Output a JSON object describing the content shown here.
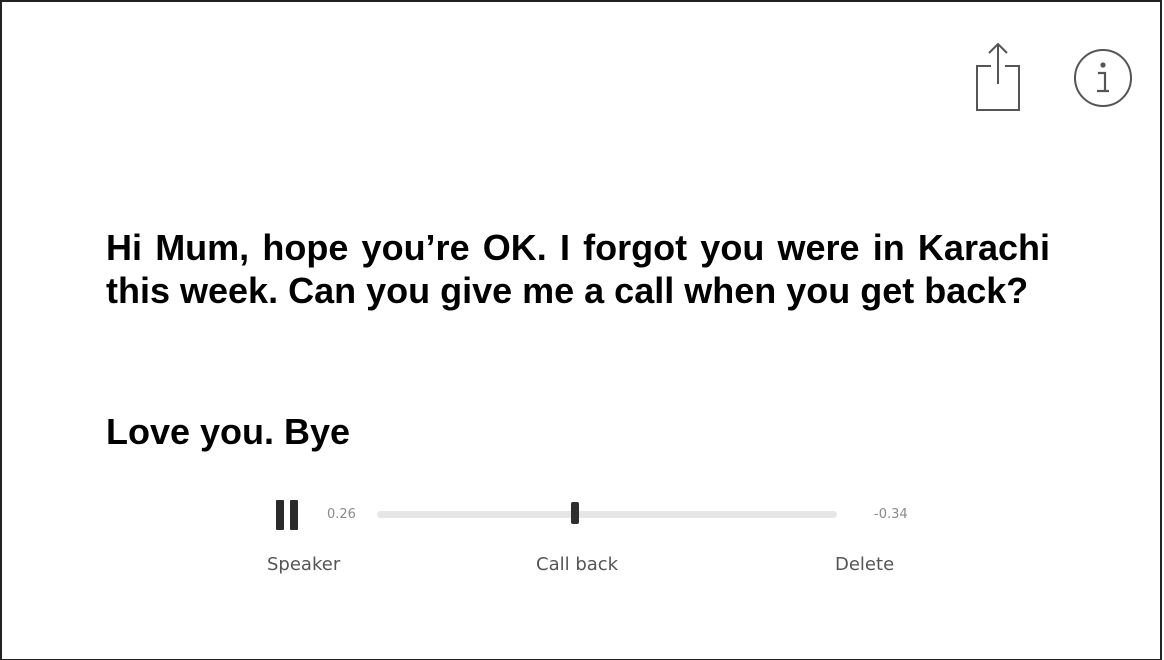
{
  "header": {
    "share_icon": "share-icon",
    "info_icon": "info-icon"
  },
  "message": {
    "body": "Hi Mum, hope you’re OK. I forgot you were in Karachi this week. Can you give me a call when you get back?",
    "signoff": "Love you. Bye"
  },
  "player": {
    "state": "playing",
    "elapsed": "0.26",
    "remaining": "-0.34",
    "progress_fraction": 0.43,
    "actions": {
      "speaker": "Speaker",
      "call_back": "Call back",
      "delete": "Delete"
    }
  }
}
